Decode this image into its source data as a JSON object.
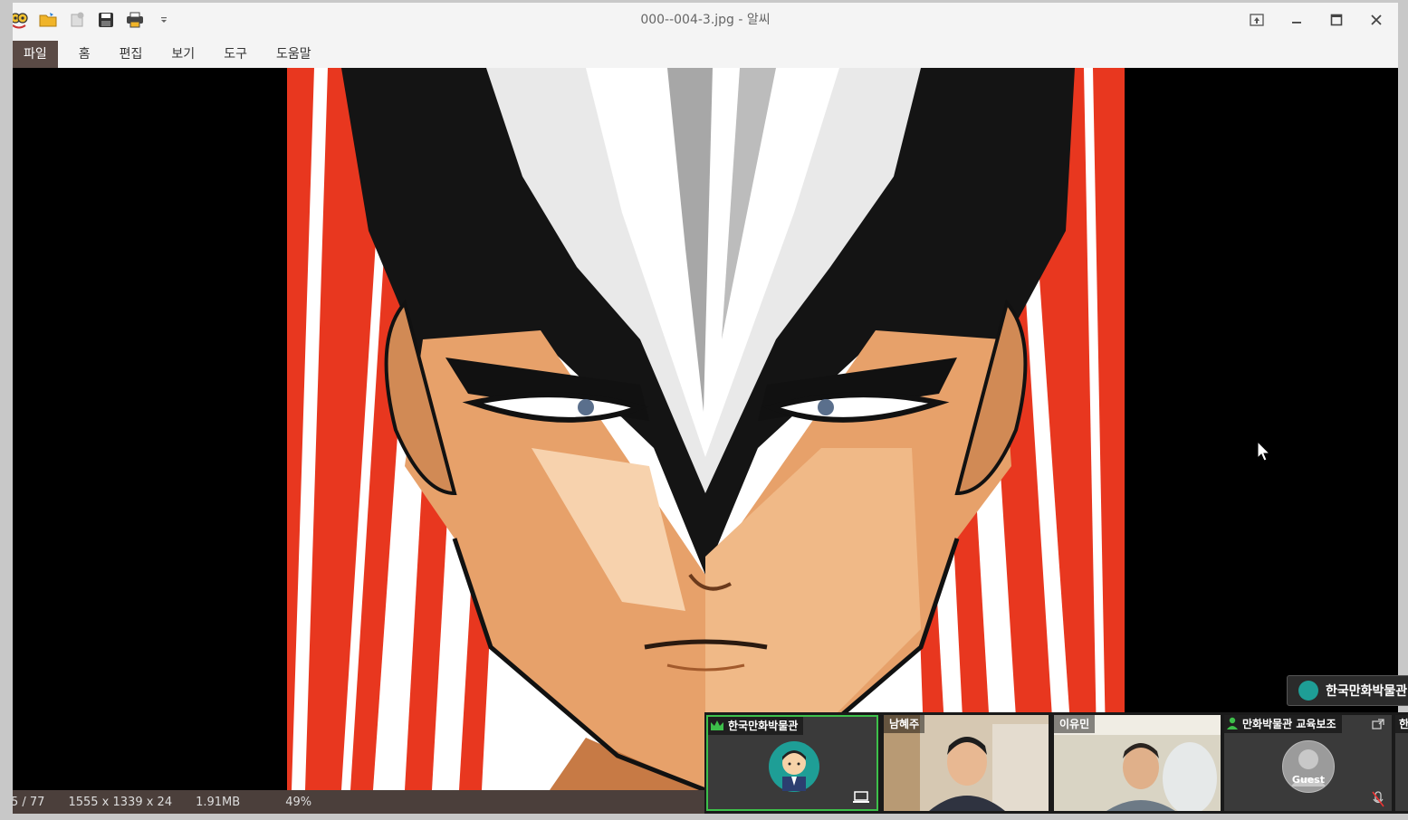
{
  "window": {
    "title": "000--004-3.jpg - 알씨",
    "quick_access": [
      "app-logo-icon",
      "open-folder-icon",
      "add-icon",
      "save-icon",
      "print-icon",
      "dropdown-icon"
    ],
    "controls": [
      "pin-icon",
      "minimize-icon",
      "maximize-icon",
      "close-icon"
    ]
  },
  "menu": {
    "items": [
      "파일",
      "홈",
      "편집",
      "보기",
      "도구",
      "도움말"
    ]
  },
  "status": {
    "index": "5 / 77",
    "dimensions": "1555 x 1339 x 24",
    "filesize": "1.91MB",
    "zoom": "49%"
  },
  "meeting": {
    "name_chip": "한국만화박물관",
    "participants": [
      {
        "name": "한국만화박물관",
        "badge": "host-crown-icon",
        "avatar": "cartoon-avatar"
      },
      {
        "name": "남혜주"
      },
      {
        "name": "이유민"
      },
      {
        "name": "만화박물관 교육보조",
        "avatar_label": "Guest"
      },
      {
        "name": "한"
      }
    ]
  },
  "colors": {
    "accent_red": "#e8371f",
    "status_bar": "#4b3f3b",
    "active_speaker": "#3dbf4a"
  }
}
